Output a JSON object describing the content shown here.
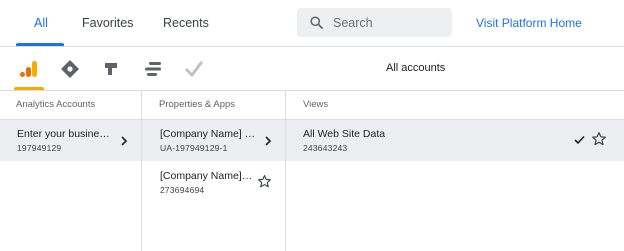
{
  "tabs": [
    {
      "label": "All",
      "active": true
    },
    {
      "label": "Favorites",
      "active": false
    },
    {
      "label": "Recents",
      "active": false
    }
  ],
  "search": {
    "placeholder": "Search"
  },
  "visit_platform_home": "Visit Platform Home",
  "products": [
    {
      "icon": "analytics-icon",
      "color": "#f9ab00",
      "active": true
    },
    {
      "icon": "tag-manager-icon",
      "color": "#5f6368"
    },
    {
      "icon": "optimize-icon",
      "color": "#5f6368"
    },
    {
      "icon": "data-studio-icon",
      "color": "#5f6368"
    },
    {
      "icon": "surveys-icon",
      "color": "#bdc1c6"
    }
  ],
  "all_accounts_label": "All accounts",
  "columns": {
    "accounts": {
      "header": "Analytics Accounts",
      "items": [
        {
          "title": "Enter your busine…",
          "id": "197949129",
          "selected": true
        }
      ]
    },
    "properties": {
      "header": "Properties & Apps",
      "items": [
        {
          "title": "[Company Name] …",
          "id": "UA-197949129-1",
          "selected": true
        },
        {
          "title": "[Company Name]…",
          "id": "273694694",
          "selected": false
        }
      ]
    },
    "views": {
      "header": "Views",
      "items": [
        {
          "title": "All Web Site Data",
          "id": "243643243",
          "selected": true
        }
      ]
    }
  },
  "colors": {
    "accent": "#1a73e8",
    "analytics": "#f9ab00",
    "selected_row": "#eceff1",
    "divider": "#dadce0"
  }
}
